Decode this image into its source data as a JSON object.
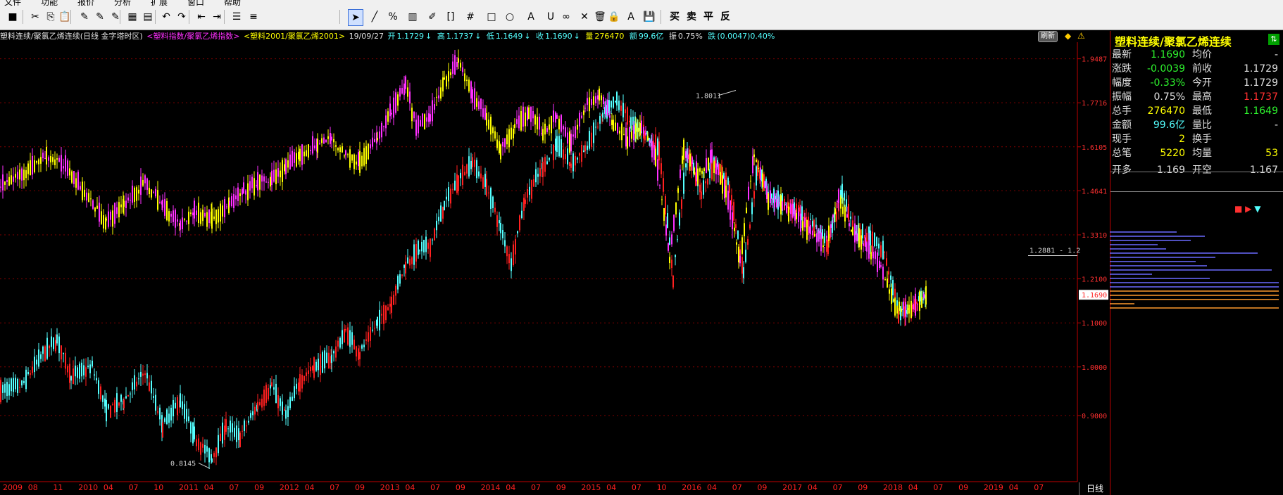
{
  "menubar": {
    "items": [
      "文件",
      "功能",
      "报价",
      "分析",
      "扩展",
      "窗口",
      "帮助"
    ]
  },
  "toolbar": {
    "buttons": [
      {
        "name": "save-icon",
        "glyph": "■"
      },
      {
        "name": "cut-icon",
        "glyph": "✂"
      },
      {
        "name": "copy-icon",
        "glyph": "⎘"
      },
      {
        "name": "paste-icon",
        "glyph": "📋"
      },
      {
        "name": "draw-tool-1-icon",
        "glyph": "✎"
      },
      {
        "name": "draw-tool-2-icon",
        "glyph": "✎"
      },
      {
        "name": "draw-tool-3-icon",
        "glyph": "✎"
      },
      {
        "name": "chart-tool-1-icon",
        "glyph": "▦"
      },
      {
        "name": "chart-tool-2-icon",
        "glyph": "▤"
      },
      {
        "name": "undo-icon",
        "glyph": "↶"
      },
      {
        "name": "redo-icon",
        "glyph": "↷"
      },
      {
        "name": "indent-icon",
        "glyph": "⇤"
      },
      {
        "name": "outdent-icon",
        "glyph": "⇥"
      },
      {
        "name": "list-icon",
        "glyph": "☰"
      },
      {
        "name": "align-icon",
        "glyph": "≡"
      },
      {
        "name": "cursor-icon",
        "glyph": "➤"
      },
      {
        "name": "line-icon",
        "glyph": "╱"
      },
      {
        "name": "percent-icon",
        "glyph": "%"
      },
      {
        "name": "ruler-icon",
        "glyph": "▥"
      },
      {
        "name": "pen-icon",
        "glyph": "✐"
      },
      {
        "name": "bracket-icon",
        "glyph": "[]"
      },
      {
        "name": "grid-icon",
        "glyph": "#"
      },
      {
        "name": "rectangle-icon",
        "glyph": "□"
      },
      {
        "name": "circle-icon",
        "glyph": "○"
      },
      {
        "name": "text-a-icon",
        "glyph": "A"
      },
      {
        "name": "magnet-icon",
        "glyph": "U"
      },
      {
        "name": "chain-icon",
        "glyph": "∞"
      },
      {
        "name": "delete-icon",
        "glyph": "✕"
      },
      {
        "name": "trash-icon",
        "glyph": "🗑"
      },
      {
        "name": "lock-icon",
        "glyph": "🔒"
      },
      {
        "name": "font-color-icon",
        "glyph": "A"
      },
      {
        "name": "save-template-icon",
        "glyph": "💾"
      }
    ],
    "trade": [
      "买",
      "卖",
      "平",
      "反"
    ]
  },
  "infobar": {
    "title": "塑料连续/聚氯乙烯连续(日线 金字塔时区)",
    "index_label": "<塑料指数/聚氯乙烯指数>",
    "contract_label": "<塑料2001/聚氯乙烯2001>",
    "date": "19/09/27",
    "open_label": "开",
    "open": "1.1729",
    "open_arrow": "↓",
    "high_label": "高",
    "high": "1.1737",
    "high_arrow": "↓",
    "low_label": "低",
    "low": "1.1649",
    "low_arrow": "↓",
    "close_label": "收",
    "close": "1.1690",
    "close_arrow": "↓",
    "vol_label": "量",
    "vol": "276470",
    "amt_label": "额",
    "amt": "99.6亿",
    "amp_label": "振",
    "amp": "0.75%",
    "chg_label": "跌",
    "chg": "(0.0047)0.40%",
    "refresh": "刷新"
  },
  "chart_data": {
    "type": "candlestick",
    "y_ticks": [
      "1.9487",
      "1.7716",
      "1.6105",
      "1.4641",
      "1.3310",
      "1.2100",
      "1.1000",
      "1.0000",
      "0.9000"
    ],
    "ylim": [
      0.78,
      2.02
    ],
    "log_scale": true,
    "x_labels": [
      "2009",
      "08",
      "11",
      "2010",
      "04",
      "07",
      "10",
      "2011",
      "04",
      "07",
      "09",
      "2012",
      "04",
      "07",
      "09",
      "2013",
      "04",
      "07",
      "09",
      "2014",
      "04",
      "07",
      "09",
      "2015",
      "04",
      "07",
      "10",
      "2016",
      "04",
      "07",
      "09",
      "2017",
      "04",
      "07",
      "09",
      "2018",
      "04",
      "07",
      "09",
      "2019",
      "04",
      "07"
    ],
    "annotations": [
      "1.8011",
      "0.8145",
      "1.2881 - 1.2"
    ],
    "last_price_tag": "1.1690",
    "series": [
      {
        "color": "#ff2020",
        "up_color": "#ff2020",
        "down_color": "#54ffff",
        "points": [
          [
            0,
            0.95
          ],
          [
            30,
            0.96
          ],
          [
            60,
            1.03
          ],
          [
            80,
            1.06
          ],
          [
            100,
            0.98
          ],
          [
            130,
            1.0
          ],
          [
            150,
            0.91
          ],
          [
            175,
            0.93
          ],
          [
            205,
            0.99
          ],
          [
            230,
            0.88
          ],
          [
            255,
            0.93
          ],
          [
            275,
            0.86
          ],
          [
            300,
            0.82
          ],
          [
            320,
            0.88
          ],
          [
            340,
            0.86
          ],
          [
            365,
            0.92
          ],
          [
            385,
            0.96
          ],
          [
            405,
            0.9
          ],
          [
            425,
            0.97
          ],
          [
            445,
            1.0
          ],
          [
            470,
            1.02
          ],
          [
            490,
            1.08
          ],
          [
            510,
            1.03
          ],
          [
            535,
            1.1
          ],
          [
            555,
            1.15
          ],
          [
            575,
            1.25
          ],
          [
            595,
            1.29
          ],
          [
            610,
            1.3
          ],
          [
            630,
            1.42
          ],
          [
            650,
            1.5
          ],
          [
            670,
            1.56
          ],
          [
            690,
            1.48
          ],
          [
            710,
            1.35
          ],
          [
            725,
            1.25
          ],
          [
            745,
            1.44
          ],
          [
            770,
            1.54
          ],
          [
            790,
            1.62
          ],
          [
            810,
            1.55
          ],
          [
            830,
            1.6
          ],
          [
            855,
            1.72
          ],
          [
            875,
            1.78
          ],
          [
            895,
            1.7
          ],
          [
            915,
            1.66
          ],
          [
            935,
            1.6
          ],
          [
            955,
            1.21
          ],
          [
            975,
            1.58
          ],
          [
            995,
            1.46
          ],
          [
            1015,
            1.56
          ],
          [
            1035,
            1.48
          ],
          [
            1055,
            1.22
          ],
          [
            1075,
            1.54
          ],
          [
            1095,
            1.44
          ],
          [
            1115,
            1.42
          ],
          [
            1135,
            1.4
          ],
          [
            1155,
            1.36
          ],
          [
            1175,
            1.3
          ],
          [
            1195,
            1.46
          ],
          [
            1215,
            1.34
          ],
          [
            1235,
            1.32
          ],
          [
            1255,
            1.28
          ],
          [
            1275,
            1.12
          ],
          [
            1295,
            1.14
          ],
          [
            1315,
            1.17
          ]
        ]
      },
      {
        "color": "#ffff00",
        "up_color": "#ffff00",
        "down_color": "#ff30ff",
        "points": [
          [
            0,
            1.48
          ],
          [
            30,
            1.52
          ],
          [
            65,
            1.58
          ],
          [
            95,
            1.54
          ],
          [
            125,
            1.44
          ],
          [
            150,
            1.37
          ],
          [
            175,
            1.42
          ],
          [
            205,
            1.49
          ],
          [
            230,
            1.42
          ],
          [
            255,
            1.36
          ],
          [
            275,
            1.4
          ],
          [
            300,
            1.38
          ],
          [
            325,
            1.42
          ],
          [
            345,
            1.46
          ],
          [
            365,
            1.49
          ],
          [
            385,
            1.5
          ],
          [
            405,
            1.54
          ],
          [
            425,
            1.58
          ],
          [
            450,
            1.62
          ],
          [
            470,
            1.64
          ],
          [
            490,
            1.58
          ],
          [
            510,
            1.56
          ],
          [
            535,
            1.64
          ],
          [
            555,
            1.74
          ],
          [
            575,
            1.84
          ],
          [
            590,
            1.68
          ],
          [
            610,
            1.72
          ],
          [
            630,
            1.86
          ],
          [
            650,
            1.94
          ],
          [
            670,
            1.8
          ],
          [
            690,
            1.72
          ],
          [
            710,
            1.6
          ],
          [
            730,
            1.68
          ],
          [
            750,
            1.74
          ],
          [
            770,
            1.66
          ],
          [
            790,
            1.72
          ],
          [
            810,
            1.62
          ],
          [
            830,
            1.76
          ],
          [
            850,
            1.8
          ],
          [
            870,
            1.7
          ],
          [
            890,
            1.64
          ],
          [
            910,
            1.68
          ],
          [
            930,
            1.58
          ],
          [
            950,
            1.26
          ],
          [
            970,
            1.6
          ],
          [
            990,
            1.52
          ],
          [
            1010,
            1.57
          ],
          [
            1030,
            1.46
          ],
          [
            1050,
            1.26
          ],
          [
            1070,
            1.58
          ],
          [
            1090,
            1.44
          ],
          [
            1110,
            1.42
          ],
          [
            1130,
            1.38
          ],
          [
            1150,
            1.34
          ],
          [
            1170,
            1.3
          ],
          [
            1190,
            1.44
          ],
          [
            1210,
            1.34
          ],
          [
            1230,
            1.3
          ],
          [
            1250,
            1.24
          ],
          [
            1270,
            1.14
          ],
          [
            1290,
            1.13
          ],
          [
            1315,
            1.17
          ]
        ]
      }
    ]
  },
  "daytab": "日线",
  "panel": {
    "title": "塑料连续/聚氯乙烯连续",
    "rows": [
      {
        "l": "最新",
        "v": "1.1690",
        "vc": "#2ef52e",
        "l2": "均价",
        "v2": "-",
        "v2c": "#e0e0e0"
      },
      {
        "l": "涨跌",
        "v": "-0.0039",
        "vc": "#2ef52e",
        "l2": "前收",
        "v2": "1.1729",
        "v2c": "#e0e0e0"
      },
      {
        "l": "幅度",
        "v": "-0.33%",
        "vc": "#2ef52e",
        "l2": "今开",
        "v2": "1.1729",
        "v2c": "#e0e0e0"
      },
      {
        "l": "振幅",
        "v": "0.75%",
        "vc": "#e0e0e0",
        "l2": "最高",
        "v2": "1.1737",
        "v2c": "#ff3030"
      },
      {
        "l": "总手",
        "v": "276470",
        "vc": "#ffff00",
        "l2": "最低",
        "v2": "1.1649",
        "v2c": "#2ef52e"
      },
      {
        "l": "金额",
        "v": "99.6亿",
        "vc": "#54ffff",
        "l2": "量比",
        "v2": "-",
        "v2c": "#e0e0e0"
      },
      {
        "l": "现手",
        "v": "2",
        "vc": "#ffff00",
        "l2": "换手",
        "v2": "",
        "v2c": "#e0e0e0"
      },
      {
        "l": "总笔",
        "v": "5220",
        "vc": "#ffff00",
        "l2": "均量",
        "v2": "53",
        "v2c": "#ffff00"
      },
      {
        "l": "开多",
        "v": "1.169",
        "vc": "#e0e0e0",
        "l2": "开空",
        "v2": "1.167",
        "v2c": "#e0e0e0"
      }
    ]
  }
}
